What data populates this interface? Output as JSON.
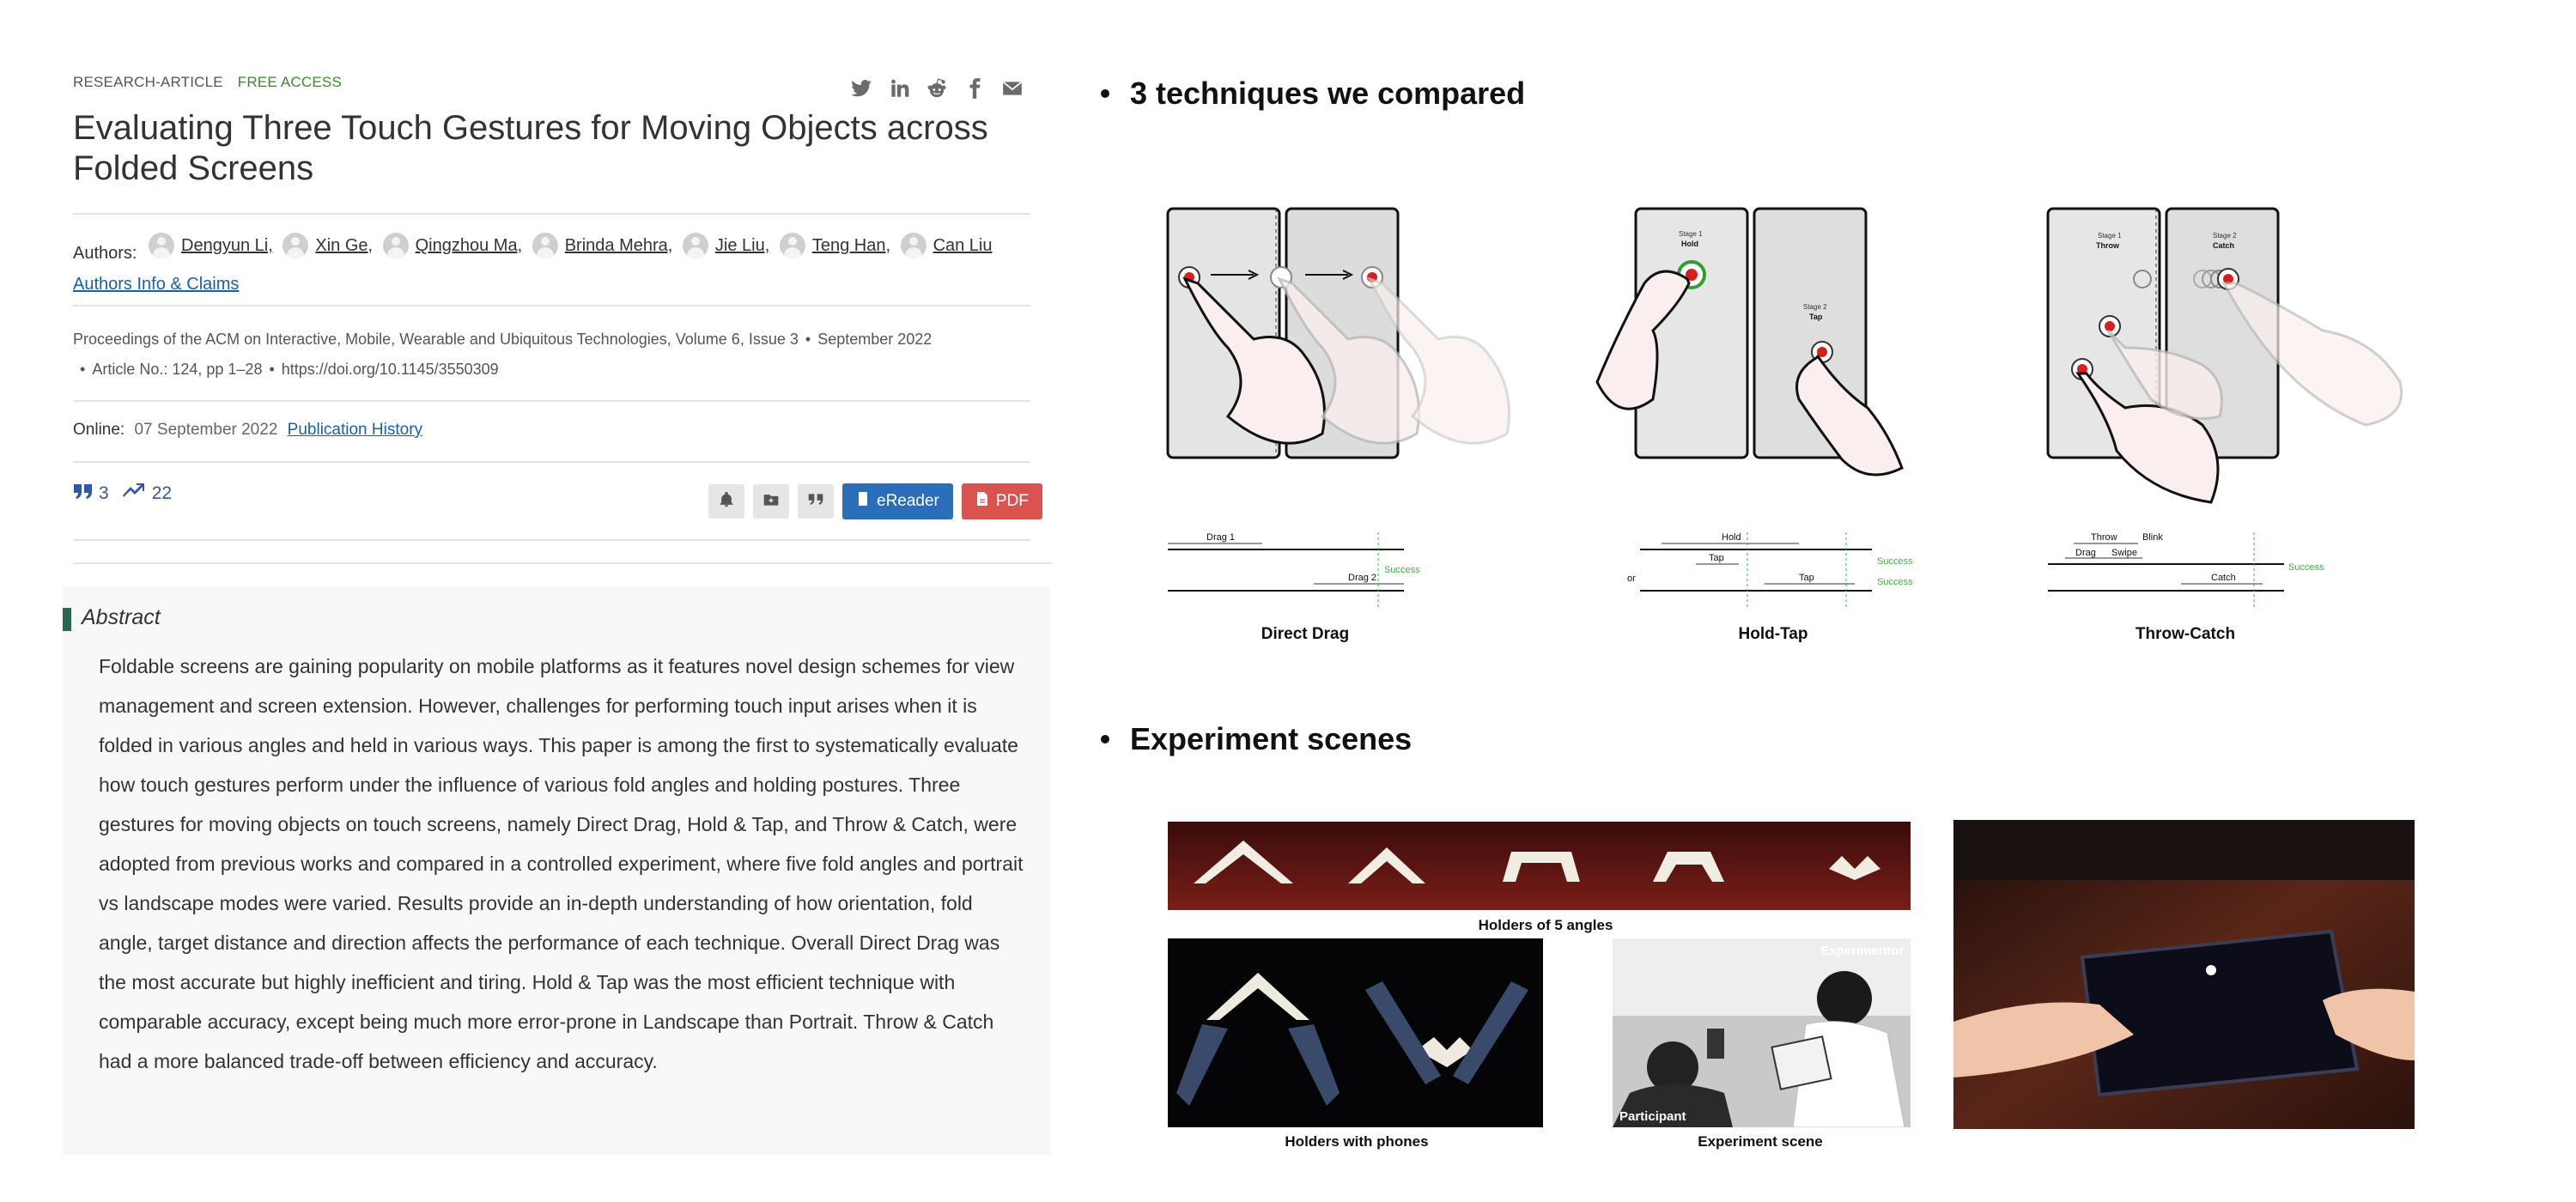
{
  "article": {
    "type_label": "RESEARCH-ARTICLE",
    "access_label": "FREE ACCESS",
    "share_icons": [
      "twitter-icon",
      "linkedin-icon",
      "reddit-icon",
      "facebook-icon",
      "email-icon"
    ],
    "title": "Evaluating Three Touch Gestures for Moving Objects across Folded Screens",
    "authors_label": "Authors:",
    "authors": [
      "Dengyun Li,",
      "Xin Ge,",
      "Qingzhou Ma,",
      "Brinda Mehra,",
      "Jie Liu,",
      "Teng Han,",
      "Can Liu"
    ],
    "authors_info_link": "Authors Info & Claims",
    "journal": "Proceedings of the ACM on Interactive, Mobile, Wearable and Ubiquitous Technologies,",
    "volume": "Volume 6,",
    "issue": "Issue 3",
    "date": "September 2022",
    "article_no": "Article No.: 124,",
    "pages": "pp 1–28",
    "doi": "https://doi.org/10.1145/3550309",
    "online_label": "Online:",
    "online_date": "07 September 2022",
    "history_link": "Publication History",
    "citations": "3",
    "downloads": "22",
    "ereader_label": "eReader",
    "pdf_label": "PDF",
    "abstract_title": "Abstract",
    "abstract_text": "Foldable screens are gaining popularity on mobile platforms as it features novel design schemes for view management and screen extension. However, challenges for performing touch input arises when it is folded in various angles and held in various ways. This paper is among the first to systematically evaluate how touch gestures perform under the influence of various fold angles and holding postures. Three gestures for moving objects on touch screens, namely Direct Drag, Hold & Tap, and Throw & Catch, were adopted from previous works and compared in a controlled experiment, where five fold angles and portrait vs landscape modes were varied. Results provide an in-depth understanding of how orientation, fold angle, target distance and direction affects the performance of each technique. Overall Direct Drag was the most accurate but highly inefficient and tiring. Hold & Tap was the most efficient technique with comparable accuracy, except being much more error-prone in Landscape than Portrait. Throw & Catch had a more balanced trade-off between efficiency and accuracy."
  },
  "slides": {
    "heading1": "3 techniques we compared",
    "heading2": "Experiment scenes",
    "techniques": [
      {
        "name": "Direct Drag",
        "stages": [],
        "timeline": {
          "row1": [
            "Drag 1"
          ],
          "row2": [
            "Drag 2"
          ],
          "or_label": "",
          "success": [
            "Success"
          ]
        }
      },
      {
        "name": "Hold-Tap",
        "stages": [
          "Stage 1",
          "Hold",
          "Stage 2",
          "Tap"
        ],
        "timeline": {
          "row1": [
            "Hold",
            "Tap"
          ],
          "row2": [
            "Tap"
          ],
          "or_label": "or",
          "success": [
            "Success",
            "Success"
          ]
        }
      },
      {
        "name": "Throw-Catch",
        "stages": [
          "Stage 1",
          "Throw",
          "Stage 2",
          "Catch"
        ],
        "timeline": {
          "row1": [
            "Throw",
            "Blink",
            "Drag",
            "Swipe"
          ],
          "row2": [
            "Catch"
          ],
          "or_label": "",
          "success": [
            "Success"
          ]
        }
      }
    ],
    "captions": {
      "holders_angles": "Holders of 5 angles",
      "holders_phones": "Holders with phones",
      "experiment_scene": "Experiment scene",
      "experimentor": "Experimentor",
      "participant": "Participant"
    }
  },
  "colors": {
    "access_green": "#3d8a2c",
    "link_blue": "#1a5faa",
    "ereader_blue": "#2a6db8",
    "pdf_red": "#d9534f",
    "abstract_bar": "#2a6650",
    "success_green": "#3cb43c"
  }
}
